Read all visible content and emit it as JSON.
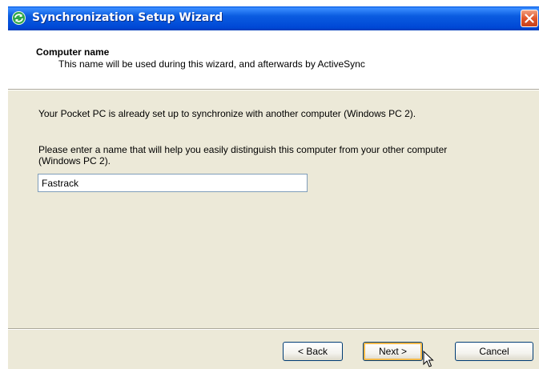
{
  "window": {
    "title": "Synchronization Setup Wizard"
  },
  "header": {
    "title": "Computer name",
    "subtitle": "This name will be used during this wizard, and afterwards by ActiveSync"
  },
  "body": {
    "paragraph1": "Your Pocket PC is already set up to synchronize with another computer (Windows PC 2).",
    "paragraph2": "Please enter a name that will help you easily distinguish this computer from your other computer (Windows PC 2).",
    "name_input_value": "Fastrack"
  },
  "buttons": {
    "back": "< Back",
    "next": "Next >",
    "cancel": "Cancel"
  },
  "icons": {
    "title_icon": "activesync-icon",
    "close": "close-icon",
    "cursor": "mouse-pointer-icon"
  },
  "colors": {
    "titlebar": "#0a5ce0",
    "dialog_bg": "#ece9d8",
    "close_button": "#e0552a",
    "default_button_focus": "#f2b94a"
  }
}
